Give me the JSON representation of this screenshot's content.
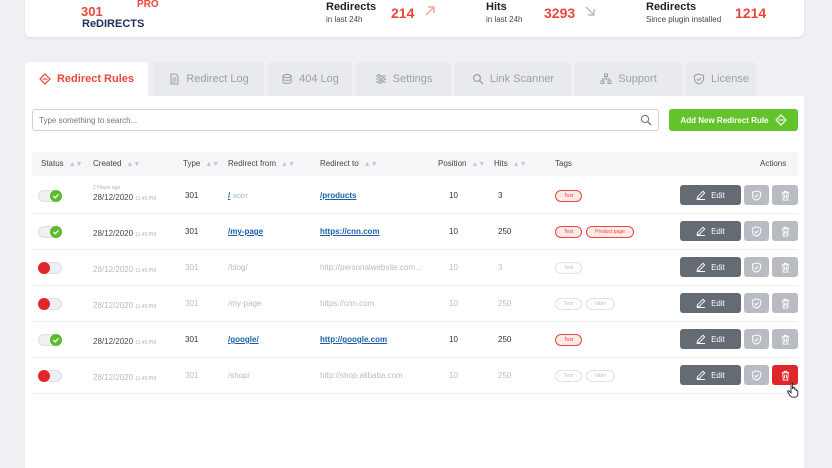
{
  "brand": {
    "line1": "301",
    "line2": "ReDIRECTS",
    "badge": "PRO",
    "accent": "#e8473a",
    "navy": "#1f2d5c"
  },
  "stats": [
    {
      "label": "Redirects",
      "sub": "in last 24h",
      "value": "214",
      "arrow": "arrow-up-right-icon"
    },
    {
      "label": "Hits",
      "sub": "in last 24h",
      "value": "3293",
      "arrow": "arrow-down-right-icon"
    },
    {
      "label": "Redirects",
      "sub": "Since plugin installed",
      "value": "1214"
    }
  ],
  "tabs": [
    {
      "label": "Redirect Rules",
      "icon": "diamond-arrows-icon",
      "active": true
    },
    {
      "label": "Redirect Log",
      "icon": "document-icon"
    },
    {
      "label": "404 Log",
      "icon": "database-icon"
    },
    {
      "label": "Settings",
      "icon": "sliders-icon"
    },
    {
      "label": "Link Scanner",
      "icon": "search-icon"
    },
    {
      "label": "Support",
      "icon": "sitemap-icon"
    },
    {
      "label": "License",
      "icon": "shield-check-icon"
    }
  ],
  "search": {
    "placeholder": "Type something to search..."
  },
  "add_button": {
    "label": "Add New Redirect Rule"
  },
  "columns": {
    "status": "Status",
    "created": "Created",
    "type": "Type",
    "from": "Redirect from",
    "to": "Redirect to",
    "position": "Position",
    "hits": "Hits",
    "tags": "Tags",
    "actions": "Actions"
  },
  "edit_label": "Edit",
  "rows": [
    {
      "enabled": true,
      "ago": "2 Hours ago",
      "date": "28/12/2020",
      "time": "11:45 PM",
      "type": "301",
      "from": "/",
      "from_note": "ROOT",
      "to": "/products",
      "position": "10",
      "hits": "3",
      "tags": [
        "Test"
      ]
    },
    {
      "enabled": true,
      "date": "28/12/2020",
      "time": "11:45 PM",
      "type": "301",
      "from": "/my-page",
      "to": "https://cnn.com",
      "position": "10",
      "hits": "250",
      "tags": [
        "Test",
        "Product page"
      ]
    },
    {
      "enabled": false,
      "date": "28/12/2020",
      "time": "11:45 PM",
      "type": "301",
      "from": "/blog/",
      "to": "http://personalwebsite.com...",
      "position": "10",
      "hits": "3",
      "tags": [
        "Test"
      ]
    },
    {
      "enabled": false,
      "date": "28/12/2020",
      "time": "11:45 PM",
      "type": "301",
      "from": "/my-page",
      "to": "https://cnn.com",
      "position": "10",
      "hits": "250",
      "tags": [
        "Test",
        "label"
      ]
    },
    {
      "enabled": true,
      "date": "28/12/2020",
      "time": "11:45 PM",
      "type": "301",
      "from": "/google/",
      "to": "http://google.com",
      "position": "10",
      "hits": "250",
      "tags": [
        "Test"
      ]
    },
    {
      "enabled": false,
      "date": "28/12/2020",
      "time": "11:45 PM",
      "type": "301",
      "from": "/shop/",
      "to": "http://shop.alibaba.com",
      "position": "10",
      "hits": "250",
      "tags": [
        "Test",
        "label"
      ],
      "delete_hover": true
    }
  ]
}
